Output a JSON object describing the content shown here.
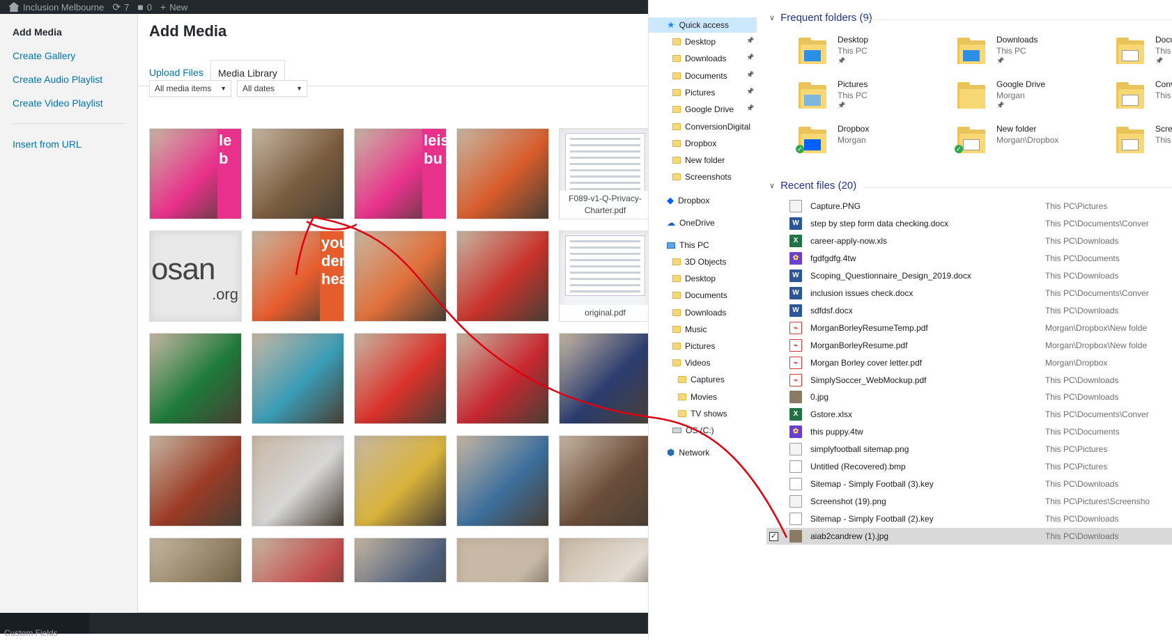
{
  "admin_bar": {
    "site_name": "Inclusion Melbourne",
    "updates_count": "7",
    "comments_count": "0",
    "new_label": "New"
  },
  "media_menu": {
    "add_media": "Add Media",
    "create_gallery": "Create Gallery",
    "create_audio_playlist": "Create Audio Playlist",
    "create_video_playlist": "Create Video Playlist",
    "insert_from_url": "Insert from URL"
  },
  "frame": {
    "title": "Add Media",
    "tabs": [
      "Upload Files",
      "Media Library"
    ],
    "active_tab": "Media Library",
    "filter_type": "All media items",
    "filter_date": "All dates"
  },
  "attachments": [
    {
      "kind": "photo",
      "overlay_text": "le\nb",
      "accent": "#e8318b"
    },
    {
      "kind": "photo",
      "accent": "#7a5c3e"
    },
    {
      "kind": "photo",
      "overlay_text": "leis\nbu",
      "accent": "#e8318b"
    },
    {
      "kind": "photo",
      "accent": "#d85c2c"
    },
    {
      "kind": "document",
      "filename": "F089-v1-Q-Privacy-Charter.pdf"
    },
    {
      "kind": "logo",
      "overlay_text": "osan",
      "sub_text": ".org"
    },
    {
      "kind": "photo",
      "overlay_text": "you\nder\nheal",
      "accent": "#e65d2d"
    },
    {
      "kind": "photo",
      "accent": "#e06f3a"
    },
    {
      "kind": "photo",
      "accent": "#c8322c"
    },
    {
      "kind": "document",
      "filename": "original.pdf"
    },
    {
      "kind": "photo",
      "accent": "#1d7a3a"
    },
    {
      "kind": "photo",
      "accent": "#3a9cb5"
    },
    {
      "kind": "photo",
      "accent": "#d9322b"
    },
    {
      "kind": "photo",
      "accent": "#c72830"
    },
    {
      "kind": "photo",
      "accent": "#2a3c6e"
    },
    {
      "kind": "photo",
      "accent": "#9c3b26"
    },
    {
      "kind": "photo",
      "accent": "#d6d6d6"
    },
    {
      "kind": "photo",
      "accent": "#d8b33b"
    },
    {
      "kind": "photo",
      "accent": "#3d6f9d"
    },
    {
      "kind": "photo",
      "accent": "#6b4d3a"
    },
    {
      "kind": "photo",
      "accent": "#8a7a5c"
    },
    {
      "kind": "photo",
      "accent": "#c34b4b"
    },
    {
      "kind": "photo",
      "accent": "#4c5e7a"
    },
    {
      "kind": "photo",
      "accent": "#c7b8a6"
    },
    {
      "kind": "photo",
      "accent": "#e3dcd3"
    }
  ],
  "explorer": {
    "nav": {
      "quick_access": "Quick access",
      "pinned": [
        "Desktop",
        "Downloads",
        "Documents",
        "Pictures",
        "Google Drive"
      ],
      "unpinned": [
        "ConversionDigital",
        "Dropbox",
        "New folder",
        "Screenshots"
      ],
      "dropbox": "Dropbox",
      "onedrive": "OneDrive",
      "this_pc": "This PC",
      "pc_items": [
        "3D Objects",
        "Desktop",
        "Documents",
        "Downloads",
        "Music",
        "Pictures",
        "Videos"
      ],
      "video_items": [
        "Captures",
        "Movies",
        "TV shows"
      ],
      "drive": "OS (C:)",
      "network": "Network"
    },
    "frequent_header": "Frequent folders (9)",
    "frequent": [
      {
        "name": "Desktop",
        "loc": "This PC",
        "pinned": true,
        "overlay": "desktop"
      },
      {
        "name": "Downloads",
        "loc": "This PC",
        "pinned": true,
        "overlay": "download"
      },
      {
        "name": "Docu",
        "loc": "This P",
        "pinned": true,
        "overlay": "doc"
      },
      {
        "name": "Pictures",
        "loc": "This PC",
        "pinned": true,
        "overlay": "pictures"
      },
      {
        "name": "Google Drive",
        "loc": "Morgan",
        "pinned": true,
        "overlay": "none"
      },
      {
        "name": "Conv",
        "loc": "This P",
        "pinned": false,
        "overlay": "doc"
      },
      {
        "name": "Dropbox",
        "loc": "Morgan",
        "pinned": false,
        "overlay": "dropbox",
        "synced": true
      },
      {
        "name": "New folder",
        "loc": "Morgan\\Dropbox",
        "pinned": false,
        "overlay": "pdf",
        "synced": true
      },
      {
        "name": "Scree",
        "loc": "This P",
        "pinned": false,
        "overlay": "screen"
      }
    ],
    "recent_header": "Recent files (20)",
    "recent": [
      {
        "name": "Capture.PNG",
        "path": "This PC\\Pictures",
        "type": "img"
      },
      {
        "name": "step by step form data checking.docx",
        "path": "This PC\\Documents\\Conver",
        "type": "word"
      },
      {
        "name": "career-apply-now.xls",
        "path": "This PC\\Downloads",
        "type": "excel"
      },
      {
        "name": "fgdfgdfg.4tw",
        "path": "This PC\\Documents",
        "type": "4tw"
      },
      {
        "name": "Scoping_Questionnaire_Design_2019.docx",
        "path": "This PC\\Downloads",
        "type": "word"
      },
      {
        "name": "inclusion issues check.docx",
        "path": "This PC\\Documents\\Conver",
        "type": "word"
      },
      {
        "name": "sdfdsf.docx",
        "path": "This PC\\Downloads",
        "type": "word"
      },
      {
        "name": "MorganBorleyResumeTemp.pdf",
        "path": "Morgan\\Dropbox\\New folde",
        "type": "pdf"
      },
      {
        "name": "MorganBorleyResume.pdf",
        "path": "Morgan\\Dropbox\\New folde",
        "type": "pdf"
      },
      {
        "name": "Morgan Borley cover letter.pdf",
        "path": "Morgan\\Dropbox",
        "type": "pdf"
      },
      {
        "name": "SimplySoccer_WebMockup.pdf",
        "path": "This PC\\Downloads",
        "type": "pdf"
      },
      {
        "name": "0.jpg",
        "path": "This PC\\Downloads",
        "type": "photo"
      },
      {
        "name": "Gstore.xlsx",
        "path": "This PC\\Documents\\Conver",
        "type": "excel"
      },
      {
        "name": "this puppy.4tw",
        "path": "This PC\\Documents",
        "type": "4tw"
      },
      {
        "name": "simplyfootball sitemap.png",
        "path": "This PC\\Pictures",
        "type": "img"
      },
      {
        "name": "Untitled (Recovered).bmp",
        "path": "This PC\\Pictures",
        "type": "blank"
      },
      {
        "name": "Sitemap - Simply Football (3).key",
        "path": "This PC\\Downloads",
        "type": "blank"
      },
      {
        "name": "Screenshot (19).png",
        "path": "This PC\\Pictures\\Screensho",
        "type": "img"
      },
      {
        "name": "Sitemap - Simply Football (2).key",
        "path": "This PC\\Downloads",
        "type": "blank"
      },
      {
        "name": "aiab2candrew (1).jpg",
        "path": "This PC\\Downloads",
        "type": "photo",
        "selected": true
      }
    ]
  },
  "colors": {
    "wp_link": "#0073aa",
    "explorer_header": "#1e3287",
    "drag_line": "#e0000f"
  },
  "bottom": {
    "custom_fields": "Custom Fields"
  }
}
